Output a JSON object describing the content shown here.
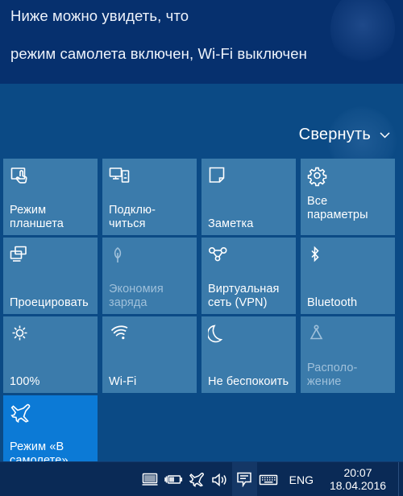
{
  "caption": {
    "line1": "Ниже можно увидеть, что",
    "line2": "режим самолета включен, Wi-Fi выключен"
  },
  "action_center": {
    "collapse_label": "Свернуть",
    "collapse_icon": "chevron-down-icon",
    "tiles": [
      {
        "label": "Режим планшета",
        "icon": "tablet-mode-icon",
        "state": "normal"
      },
      {
        "label": "Подклю-читься",
        "icon": "connect-display-icon",
        "state": "normal"
      },
      {
        "label": "Заметка",
        "icon": "note-icon",
        "state": "normal"
      },
      {
        "label": "Все параметры",
        "icon": "gear-icon",
        "state": "normal"
      },
      {
        "label": "Проецировать",
        "icon": "project-screen-icon",
        "state": "normal"
      },
      {
        "label": "Экономия заряда",
        "icon": "battery-saver-leaf-icon",
        "state": "disabled"
      },
      {
        "label": "Виртуальная сеть (VPN)",
        "icon": "vpn-icon",
        "state": "normal"
      },
      {
        "label": "Bluetooth",
        "icon": "bluetooth-icon",
        "state": "normal"
      },
      {
        "label": "100%",
        "icon": "brightness-sun-icon",
        "state": "normal"
      },
      {
        "label": "Wi-Fi",
        "icon": "wifi-off-icon",
        "state": "normal"
      },
      {
        "label": "Не беспокоить",
        "icon": "moon-icon",
        "state": "normal"
      },
      {
        "label": "Располо-жение",
        "icon": "location-pin-icon",
        "state": "disabled"
      },
      {
        "label": "Режим «В самолете»",
        "icon": "airplane-icon",
        "state": "active"
      }
    ]
  },
  "taskbar": {
    "tray_icons": [
      "touchpad-icon",
      "battery-charging-icon",
      "airplane-icon",
      "volume-icon",
      "action-center-icon",
      "keyboard-icon"
    ],
    "language": "ENG",
    "time": "20:07",
    "date": "18.04.2016"
  },
  "colors": {
    "caption_background": "#06306e",
    "panel_background": "#0b4a85",
    "tile_background": "#3b7bab",
    "tile_active": "#0c7ad6",
    "tile_disabled_text": "#9fc0da",
    "taskbar_background": "#0a2a56",
    "text": "#ffffff"
  }
}
